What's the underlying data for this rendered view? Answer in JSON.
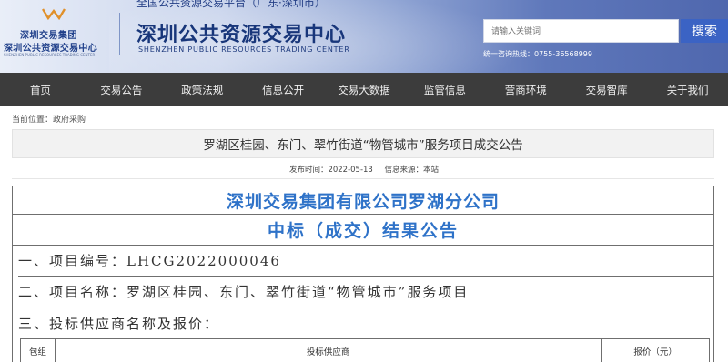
{
  "header": {
    "logo_line1": "深圳交易集团",
    "logo_line2": "深圳公共资源交易中心",
    "logo_line3": "SHENZHEN PUBLIC RESOURCES TRADING CENTER",
    "top_cut_text": "全国公共资源交易平台（广东·深圳市）",
    "title": "深圳公共资源交易中心",
    "subtitle": "SHENZHEN PUBLIC RESOURCES TRADING CENTER",
    "search_placeholder": "请输入关键词",
    "search_button": "搜索",
    "hotline": "统一咨询热线：0755-36568999",
    "brand_color": "#3b63c4"
  },
  "nav": {
    "items": [
      "首页",
      "交易公告",
      "政策法规",
      "信息公开",
      "交易大数据",
      "监管信息",
      "营商环境",
      "交易智库",
      "关于我们"
    ]
  },
  "breadcrumb": {
    "label": "当前位置：",
    "current": "政府采购"
  },
  "article": {
    "title": "罗湖区桂园、东门、翠竹街道“物管城市”服务项目成交公告",
    "publish_time": "发布时间：2022-05-13",
    "source": "信息来源：本站"
  },
  "document": {
    "org_name": "深圳交易集团有限公司罗湖分公司",
    "notice_title": "中标（成交）结果公告",
    "line1": "一、项目编号：LHCG2022000046",
    "line2": "二、项目名称：罗湖区桂园、东门、翠竹街道“物管城市”服务项目",
    "line3": "三、投标供应商名称及报价：",
    "table_headers": [
      "包组",
      "投标供应商",
      "报价（元）"
    ],
    "heading_color": "#2e72c8"
  }
}
